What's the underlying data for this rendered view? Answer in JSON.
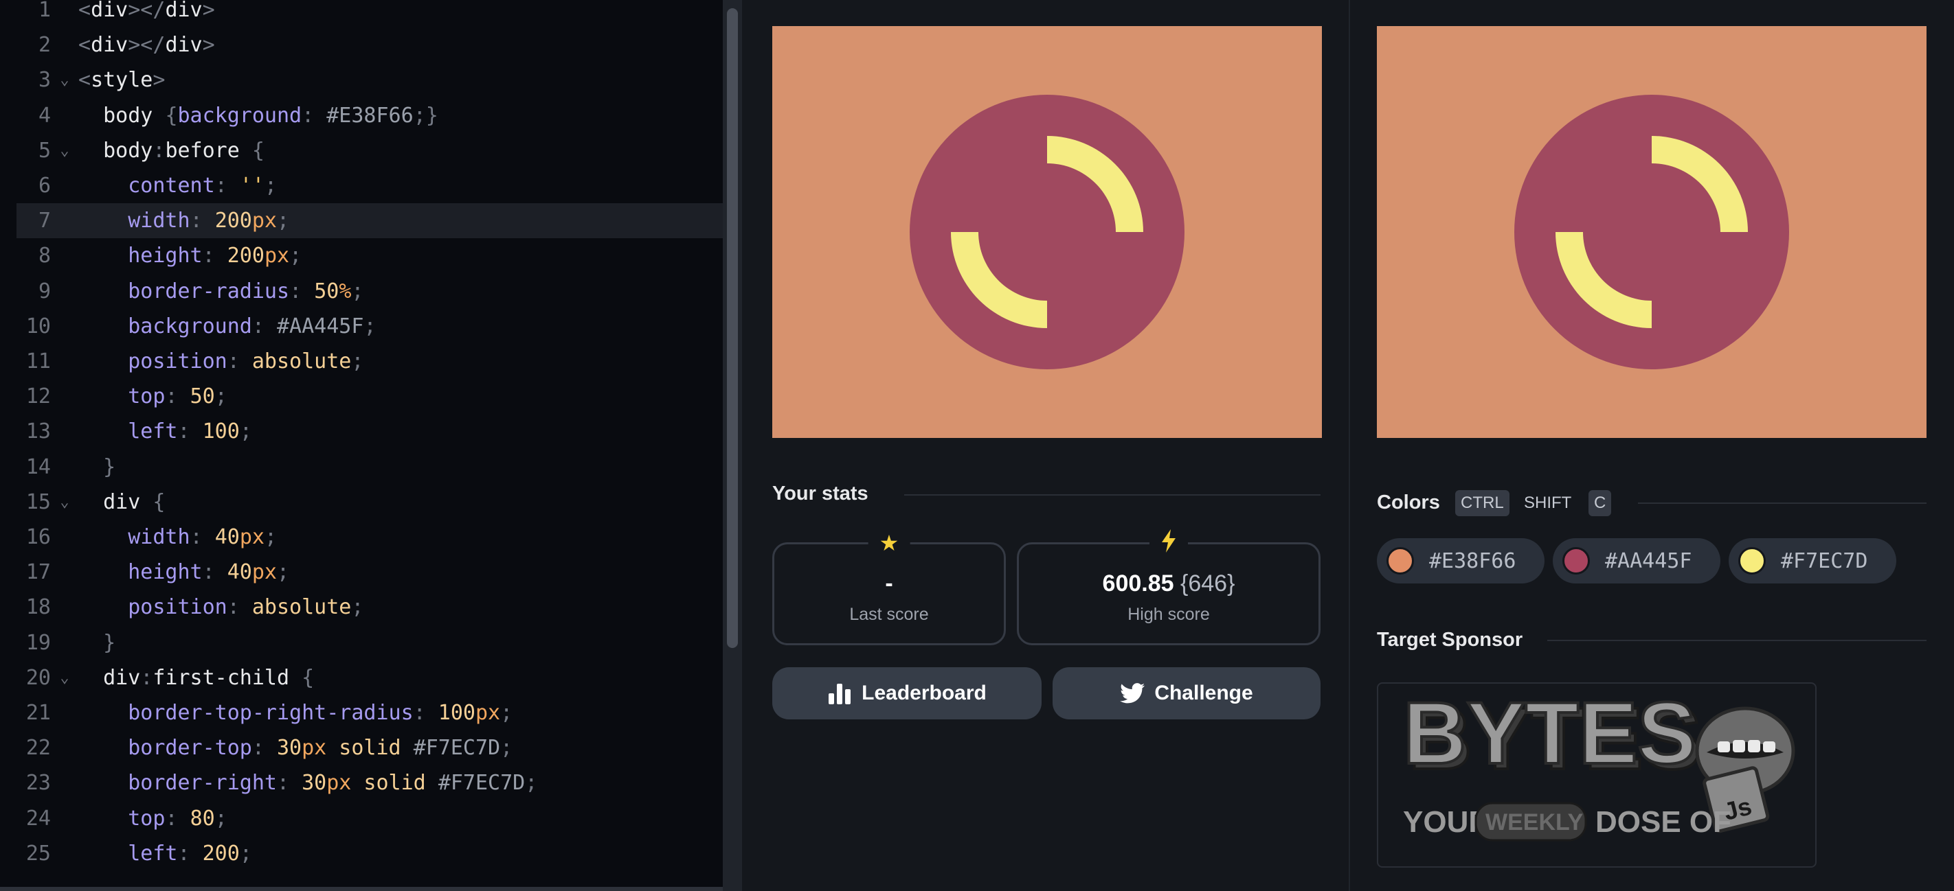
{
  "editor": {
    "lines": [
      {
        "n": "1",
        "fold": ""
      },
      {
        "n": "2",
        "fold": ""
      },
      {
        "n": "3",
        "fold": "⌄"
      },
      {
        "n": "4",
        "fold": ""
      },
      {
        "n": "5",
        "fold": "⌄"
      },
      {
        "n": "6",
        "fold": ""
      },
      {
        "n": "7",
        "fold": ""
      },
      {
        "n": "8",
        "fold": ""
      },
      {
        "n": "9",
        "fold": ""
      },
      {
        "n": "10",
        "fold": ""
      },
      {
        "n": "11",
        "fold": ""
      },
      {
        "n": "12",
        "fold": ""
      },
      {
        "n": "13",
        "fold": ""
      },
      {
        "n": "14",
        "fold": ""
      },
      {
        "n": "15",
        "fold": "⌄"
      },
      {
        "n": "16",
        "fold": ""
      },
      {
        "n": "17",
        "fold": ""
      },
      {
        "n": "18",
        "fold": ""
      },
      {
        "n": "19",
        "fold": ""
      },
      {
        "n": "20",
        "fold": "⌄"
      },
      {
        "n": "21",
        "fold": ""
      },
      {
        "n": "22",
        "fold": ""
      },
      {
        "n": "23",
        "fold": ""
      },
      {
        "n": "24",
        "fold": ""
      },
      {
        "n": "25",
        "fold": ""
      }
    ],
    "code": {
      "l1_a": "<",
      "l1_b": "div",
      "l1_c": "></",
      "l1_d": "div",
      "l1_e": ">",
      "l2_a": "<",
      "l2_b": "div",
      "l2_c": "></",
      "l2_d": "div",
      "l2_e": ">",
      "l3_a": "<",
      "l3_b": "style",
      "l3_c": ">",
      "l4_indent": "  ",
      "l4_sel": "body ",
      "l4_ob": "{",
      "l4_prop": "background",
      "l4_colon": ": ",
      "l4_val": "#E38F66",
      "l4_semi": ";",
      "l4_cb": "}",
      "l5_indent": "  ",
      "l5_sel": "body",
      "l5_pseudo": ":",
      "l5_sel2": "before ",
      "l5_ob": "{",
      "l6_indent": "    ",
      "l6_prop": "content",
      "l6_colon": ": ",
      "l6_val": "''",
      "l6_semi": ";",
      "l7_indent": "    ",
      "l7_prop": "width",
      "l7_colon": ": ",
      "l7_num": "200",
      "l7_unit": "px",
      "l7_semi": ";",
      "l8_indent": "    ",
      "l8_prop": "height",
      "l8_colon": ": ",
      "l8_num": "200",
      "l8_unit": "px",
      "l8_semi": ";",
      "l9_indent": "    ",
      "l9_prop": "border-radius",
      "l9_colon": ": ",
      "l9_num": "50",
      "l9_unit": "%",
      "l9_semi": ";",
      "l10_indent": "    ",
      "l10_prop": "background",
      "l10_colon": ": ",
      "l10_val": "#AA445F",
      "l10_semi": ";",
      "l11_indent": "    ",
      "l11_prop": "position",
      "l11_colon": ": ",
      "l11_val": "absolute",
      "l11_semi": ";",
      "l12_indent": "    ",
      "l12_prop": "top",
      "l12_colon": ": ",
      "l12_num": "50",
      "l12_semi": ";",
      "l13_indent": "    ",
      "l13_prop": "left",
      "l13_colon": ": ",
      "l13_num": "100",
      "l13_semi": ";",
      "l14_indent": "  ",
      "l14_cb": "}",
      "l15_indent": "  ",
      "l15_sel": "div ",
      "l15_ob": "{",
      "l16_indent": "    ",
      "l16_prop": "width",
      "l16_colon": ": ",
      "l16_num": "40",
      "l16_unit": "px",
      "l16_semi": ";",
      "l17_indent": "    ",
      "l17_prop": "height",
      "l17_colon": ": ",
      "l17_num": "40",
      "l17_unit": "px",
      "l17_semi": ";",
      "l18_indent": "    ",
      "l18_prop": "position",
      "l18_colon": ": ",
      "l18_val": "absolute",
      "l18_semi": ";",
      "l19_indent": "  ",
      "l19_cb": "}",
      "l20_indent": "  ",
      "l20_sel": "div",
      "l20_pseudo": ":",
      "l20_sel2": "first-child ",
      "l20_ob": "{",
      "l21_indent": "    ",
      "l21_prop": "border-top-right-radius",
      "l21_colon": ": ",
      "l21_num": "100",
      "l21_unit": "px",
      "l21_semi": ";",
      "l22_indent": "    ",
      "l22_prop": "border-top",
      "l22_colon": ": ",
      "l22_num": "30",
      "l22_unit": "px",
      "l22_kw": " solid ",
      "l22_hex": "#F7EC7D",
      "l22_semi": ";",
      "l23_indent": "    ",
      "l23_prop": "border-right",
      "l23_colon": ": ",
      "l23_num": "30",
      "l23_unit": "px",
      "l23_kw": " solid ",
      "l23_hex": "#F7EC7D",
      "l23_semi": ";",
      "l24_indent": "    ",
      "l24_prop": "top",
      "l24_colon": ": ",
      "l24_num": "80",
      "l24_semi": ";",
      "l25_indent": "    ",
      "l25_prop": "left",
      "l25_colon": ": ",
      "l25_num": "200",
      "l25_semi": ";"
    },
    "active_line": 7
  },
  "stats": {
    "title": "Your stats",
    "last_score_value": "-",
    "last_score_label": "Last score",
    "high_score_value": "600.85",
    "high_score_sub": "{646}",
    "high_score_label": "High score",
    "last_icon": "star-icon",
    "high_icon": "bolt-icon"
  },
  "actions": {
    "leaderboard": "Leaderboard",
    "challenge": "Challenge"
  },
  "colors": {
    "title": "Colors",
    "shortcut_ctrl": "CTRL",
    "shortcut_shift": "SHIFT",
    "shortcut_key": "C",
    "swatches": [
      {
        "hex": "#E38F66",
        "color": "#E38F66"
      },
      {
        "hex": "#AA445F",
        "color": "#AA445F"
      },
      {
        "hex": "#F7EC7D",
        "color": "#F7EC7D"
      }
    ]
  },
  "sponsor": {
    "title": "Target Sponsor",
    "logo_word": "BYTES",
    "tagline_your": "YOUR",
    "tagline_weekly": "WEEKLY",
    "tagline_dose": "DOSE OF",
    "badge": "Js"
  },
  "palette": {
    "background": "#d7926e",
    "circle": "#a0495f",
    "arc": "#f5ec83",
    "accent_star": "#f5cf3a"
  }
}
